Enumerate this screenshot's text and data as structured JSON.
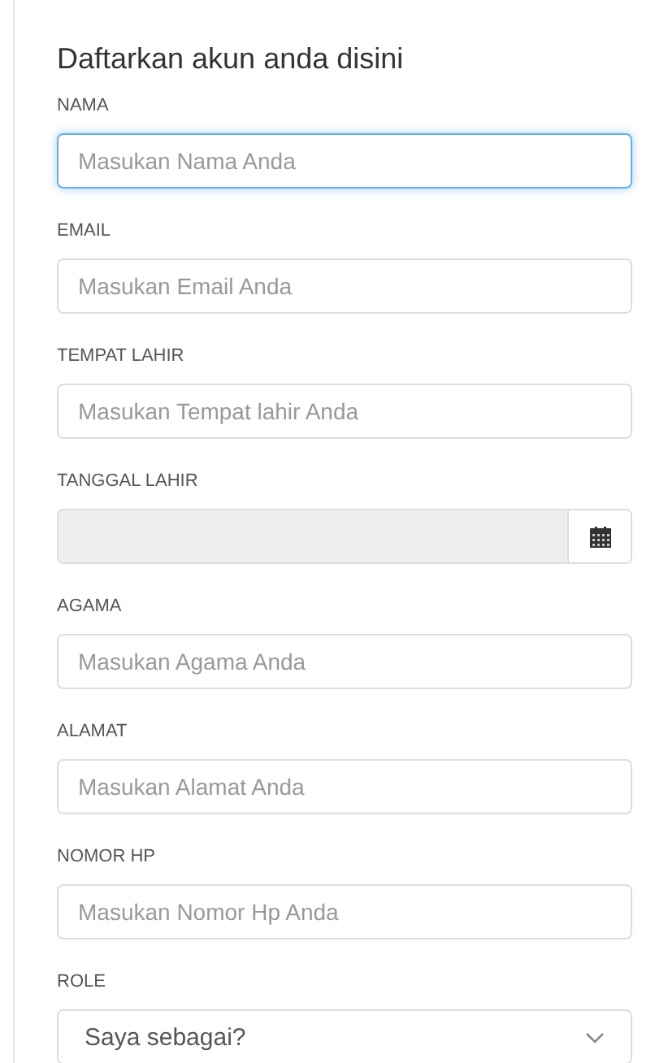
{
  "title": "Daftarkan akun anda disini",
  "fields": [
    {
      "kind": "text",
      "label": "NAMA",
      "placeholder": "Masukan Nama Anda",
      "focused": true
    },
    {
      "kind": "text",
      "label": "EMAIL",
      "placeholder": "Masukan Email Anda",
      "focused": false
    },
    {
      "kind": "text",
      "label": "TEMPAT LAHIR",
      "placeholder": "Masukan Tempat lahir Anda",
      "focused": false
    },
    {
      "kind": "date",
      "label": "TANGGAL LAHIR",
      "focused": false
    },
    {
      "kind": "text",
      "label": "AGAMA",
      "placeholder": "Masukan Agama Anda",
      "focused": false
    },
    {
      "kind": "text",
      "label": "ALAMAT",
      "placeholder": "Masukan Alamat Anda",
      "focused": false
    },
    {
      "kind": "text",
      "label": "NOMOR HP",
      "placeholder": "Masukan Nomor Hp Anda",
      "focused": false
    },
    {
      "kind": "select",
      "label": "ROLE",
      "value": "Saya sebagai?",
      "focused": false
    }
  ]
}
